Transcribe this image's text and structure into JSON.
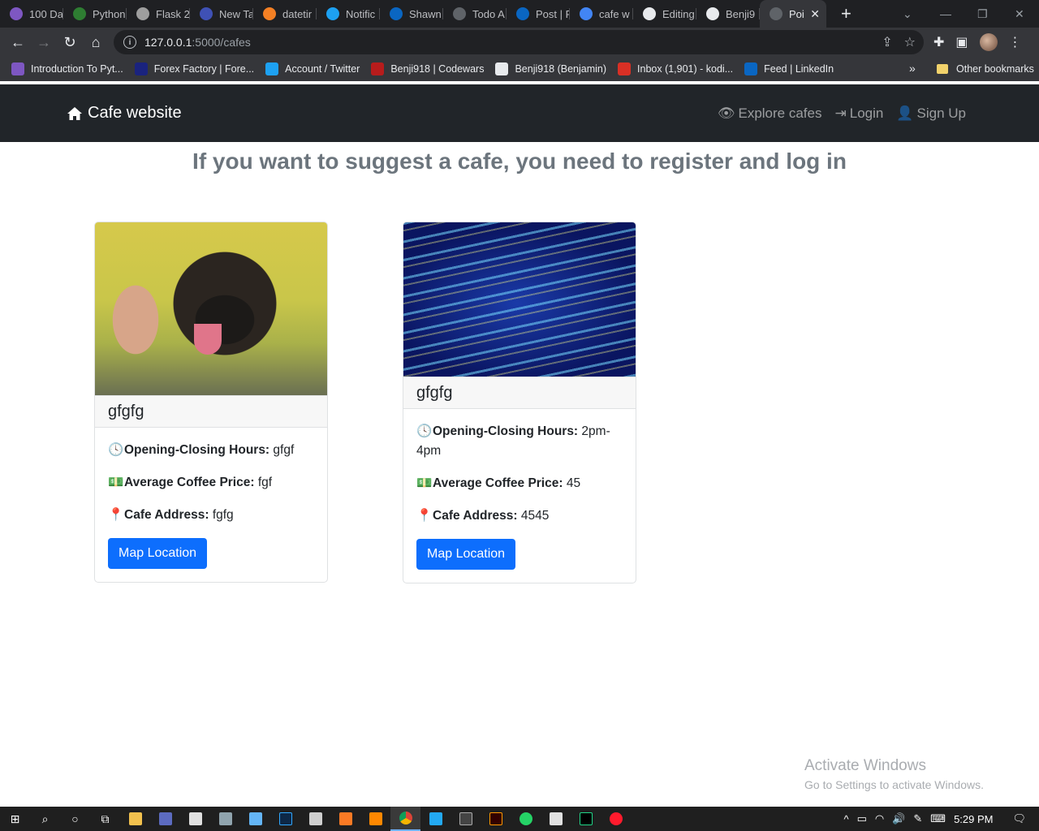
{
  "browser": {
    "tabs": [
      {
        "label": "100 Da",
        "color": "#7e57c2"
      },
      {
        "label": "Python",
        "color": "#2e7d32"
      },
      {
        "label": "Flask 2",
        "color": "#9e9e9e"
      },
      {
        "label": "New Ta",
        "color": "#3f51b5"
      },
      {
        "label": "datetir",
        "color": "#f48024"
      },
      {
        "label": "Notific",
        "color": "#1da1f2"
      },
      {
        "label": "Shawn",
        "color": "#0a66c2"
      },
      {
        "label": "Todo A",
        "color": "#5f6368"
      },
      {
        "label": "Post | F",
        "color": "#0a66c2"
      },
      {
        "label": "cafe w",
        "color": "#4285f4"
      },
      {
        "label": "Editing",
        "color": "#e8eaed"
      },
      {
        "label": "Benji9",
        "color": "#e8eaed"
      },
      {
        "label": "Poi",
        "color": "#5f6368",
        "active": true
      }
    ],
    "new_tab": "+",
    "url_host": "127.0.0.1",
    "url_path": ":5000/cafes",
    "bookmarks": [
      {
        "label": "Introduction To Pyt...",
        "color": "#7e57c2"
      },
      {
        "label": "Forex Factory | Fore...",
        "color": "#1a237e"
      },
      {
        "label": "Account / Twitter",
        "color": "#1da1f2"
      },
      {
        "label": "Benji918 | Codewars",
        "color": "#b71c1c"
      },
      {
        "label": "Benji918 (Benjamin)",
        "color": "#e8eaed"
      },
      {
        "label": "Inbox (1,901) - kodi...",
        "color": "#d93025"
      },
      {
        "label": "Feed | LinkedIn",
        "color": "#0a66c2"
      }
    ],
    "bookmarks_more": "»",
    "other_bookmarks": "Other bookmarks"
  },
  "site": {
    "brand": "Cafe website",
    "nav": {
      "explore": "Explore cafes",
      "login": "Login",
      "signup": "Sign Up"
    },
    "headline": "If you want to suggest a cafe, you need to register and log in"
  },
  "cafes": [
    {
      "name": "gfgfg",
      "hours_label": "Opening-Closing Hours:",
      "hours": "gfgf",
      "price_label": "Average Coffee Price:",
      "price": "fgf",
      "address_label": "Cafe Address:",
      "address": "fgfg",
      "button": "Map Location",
      "image": "dog-photo"
    },
    {
      "name": "gfgfg",
      "hours_label": "Opening-Closing Hours:",
      "hours": "2pm-4pm",
      "price_label": "Average Coffee Price:",
      "price": "45",
      "address_label": "Cafe Address:",
      "address": "4545",
      "button": "Map Location",
      "image": "code-photo"
    }
  ],
  "watermark": {
    "title": "Activate Windows",
    "subtitle": "Go to Settings to activate Windows."
  },
  "taskbar": {
    "time": "5:29 PM"
  }
}
